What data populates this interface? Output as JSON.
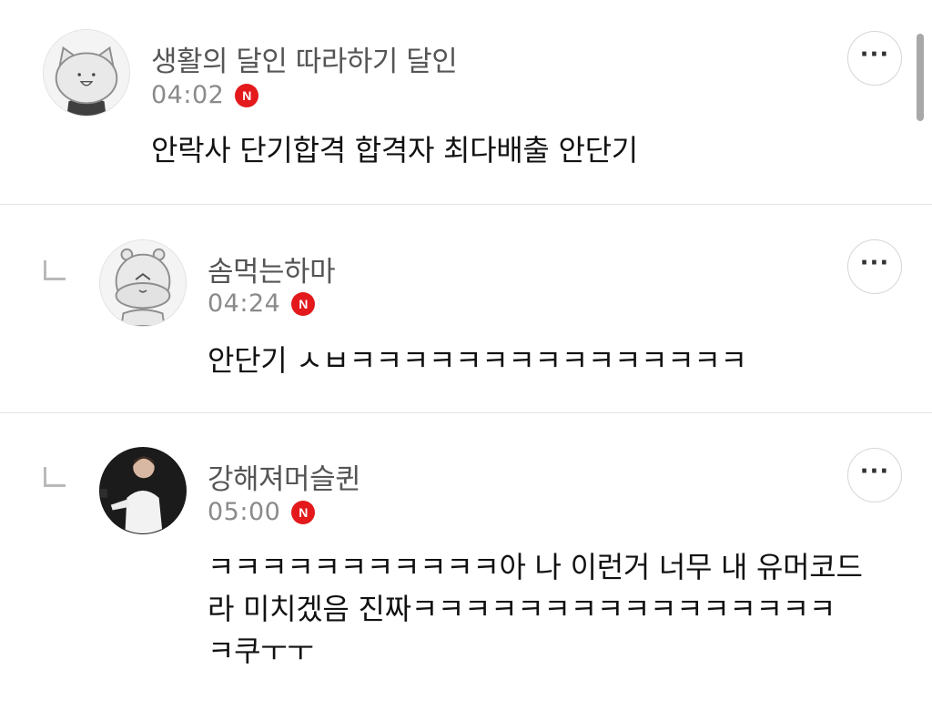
{
  "comments": [
    {
      "author": "생활의 달인 따라하기 달인",
      "time": "04:02",
      "badge": "N",
      "text": "안락사 단기합격 합격자 최다배출 안단기",
      "more_icon": "more-horizontal-icon"
    },
    {
      "author": "솜먹는하마",
      "time": "04:24",
      "badge": "N",
      "text": "안단기 ㅅㅂㅋㅋㅋㅋㅋㅋㅋㅋㅋㅋㅋㅋㅋㅋㅋ",
      "more_icon": "more-horizontal-icon"
    },
    {
      "author": "강해져머슬퀸",
      "time": "05:00",
      "badge": "N",
      "text_lines": [
        "ㅋㅋㅋㅋㅋㅋㅋㅋㅋㅋㅋ아 나 이런거 너무 내 유머코드",
        "라 미치겠음 진짜ㅋㅋㅋㅋㅋㅋㅋㅋㅋㅋㅋㅋㅋㅋㅋㅋ",
        "ㅋ쿠ㅜㅜ"
      ],
      "more_icon": "more-horizontal-icon"
    }
  ],
  "colors": {
    "badge": "#e3191c",
    "author": "#555555",
    "time": "#8a8a8a",
    "divider": "#e4e4e4"
  }
}
